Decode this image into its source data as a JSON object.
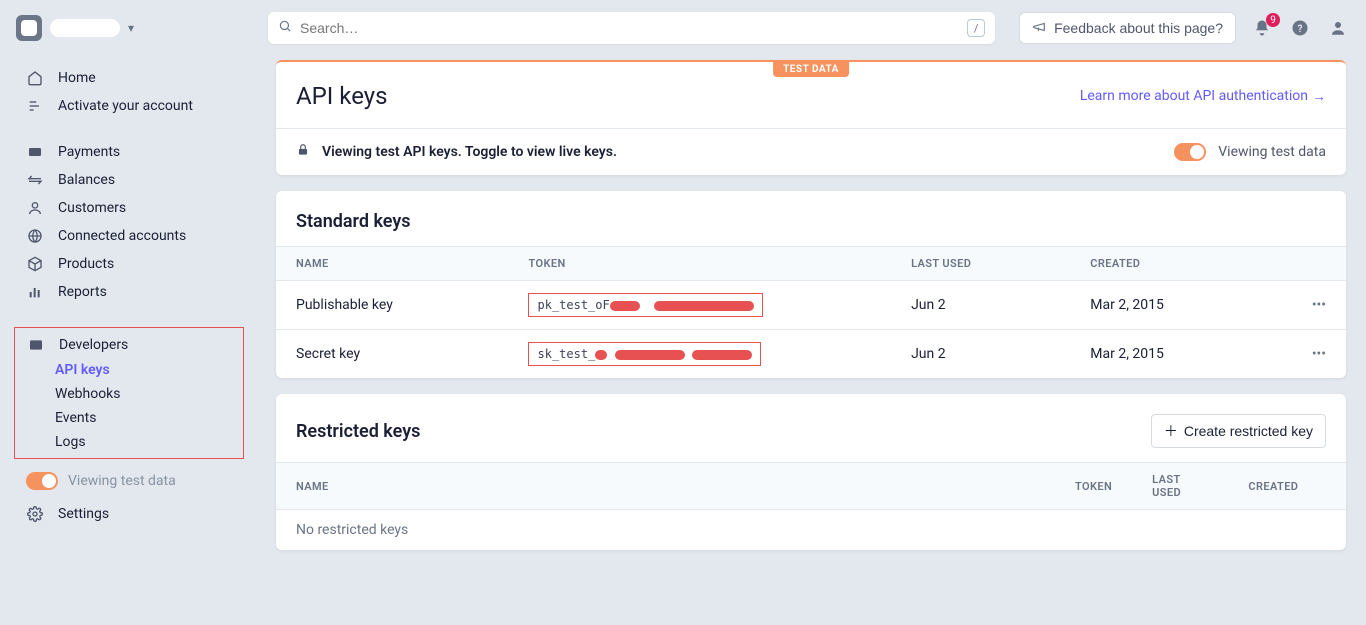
{
  "topbar": {
    "search_placeholder": "Search…",
    "slash_hint": "/",
    "feedback_label": "Feedback about this page?",
    "notification_count": "9"
  },
  "sidebar": {
    "primary": [
      {
        "id": "home",
        "label": "Home"
      },
      {
        "id": "activate",
        "label": "Activate your account"
      }
    ],
    "business": [
      {
        "id": "payments",
        "label": "Payments"
      },
      {
        "id": "balances",
        "label": "Balances"
      },
      {
        "id": "customers",
        "label": "Customers"
      },
      {
        "id": "connected",
        "label": "Connected accounts"
      },
      {
        "id": "products",
        "label": "Products"
      },
      {
        "id": "reports",
        "label": "Reports"
      }
    ],
    "developers_label": "Developers",
    "developers_sub": [
      {
        "id": "api-keys",
        "label": "API keys",
        "active": true
      },
      {
        "id": "webhooks",
        "label": "Webhooks"
      },
      {
        "id": "events",
        "label": "Events"
      },
      {
        "id": "logs",
        "label": "Logs"
      }
    ],
    "test_toggle_label": "Viewing test data",
    "settings_label": "Settings"
  },
  "page": {
    "test_badge": "TEST DATA",
    "title": "API keys",
    "learn_more": "Learn more about API authentication",
    "info_text": "Viewing test API keys. Toggle to view live keys.",
    "info_toggle_label": "Viewing test data"
  },
  "standard_keys": {
    "title": "Standard keys",
    "columns": {
      "name": "NAME",
      "token": "TOKEN",
      "last_used": "LAST USED",
      "created": "CREATED"
    },
    "rows": [
      {
        "name": "Publishable key",
        "token_prefix": "pk_test_oF",
        "last_used": "Jun 2",
        "created": "Mar 2, 2015"
      },
      {
        "name": "Secret key",
        "token_prefix": "sk_test_",
        "last_used": "Jun 2",
        "created": "Mar 2, 2015"
      }
    ]
  },
  "restricted_keys": {
    "title": "Restricted keys",
    "create_label": "Create restricted key",
    "columns": {
      "name": "NAME",
      "token": "TOKEN",
      "last_used": "LAST USED",
      "created": "CREATED"
    },
    "empty_text": "No restricted keys"
  }
}
